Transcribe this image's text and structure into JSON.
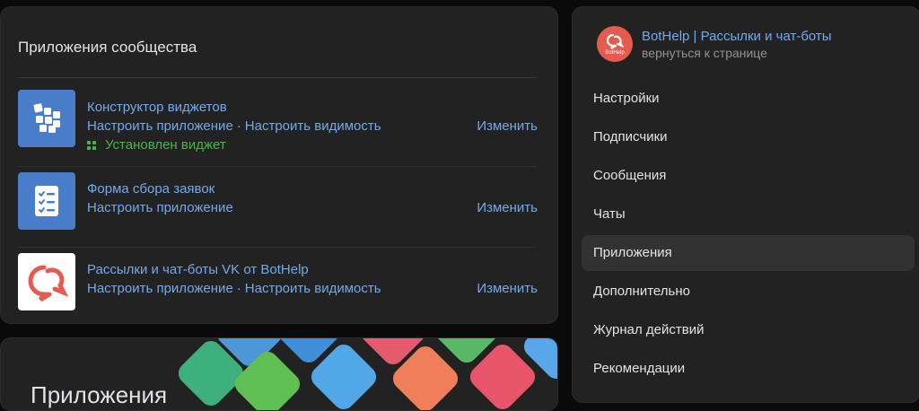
{
  "apps": {
    "title": "Приложения сообщества",
    "items": [
      {
        "name": "Конструктор виджетов",
        "link1": "Настроить приложение",
        "link2": "Настроить видимость",
        "edit": "Изменить",
        "status": "Установлен виджет",
        "icon": "widget-grid-icon",
        "color": "#4a7dc9"
      },
      {
        "name": "Форма сбора заявок",
        "link1": "Настроить приложение",
        "edit": "Изменить",
        "icon": "checklist-form-icon",
        "color": "#4a7dc9"
      },
      {
        "name": "Рассылки и чат-боты VK от BotHelp",
        "link1": "Настроить приложение",
        "link2": "Настроить видимость",
        "edit": "Изменить",
        "icon": "bothelp-icon",
        "color": "#ffffff"
      }
    ],
    "separator": "·"
  },
  "banner": {
    "title": "Приложения"
  },
  "sidebar": {
    "community_name": "BotHelp | Рассылки и чат-боты",
    "back_link": "вернуться к странице",
    "logo_text": "BotHelp",
    "items": [
      {
        "label": "Настройки",
        "active": false
      },
      {
        "label": "Подписчики",
        "active": false
      },
      {
        "label": "Сообщения",
        "active": false
      },
      {
        "label": "Чаты",
        "active": false
      },
      {
        "label": "Приложения",
        "active": true
      },
      {
        "label": "Дополнительно",
        "active": false
      },
      {
        "label": "Журнал действий",
        "active": false
      },
      {
        "label": "Рекомендации",
        "active": false
      }
    ]
  },
  "colors": {
    "link": "#71aaeb",
    "success": "#4bb34b",
    "brand_red": "#e55b4d"
  }
}
